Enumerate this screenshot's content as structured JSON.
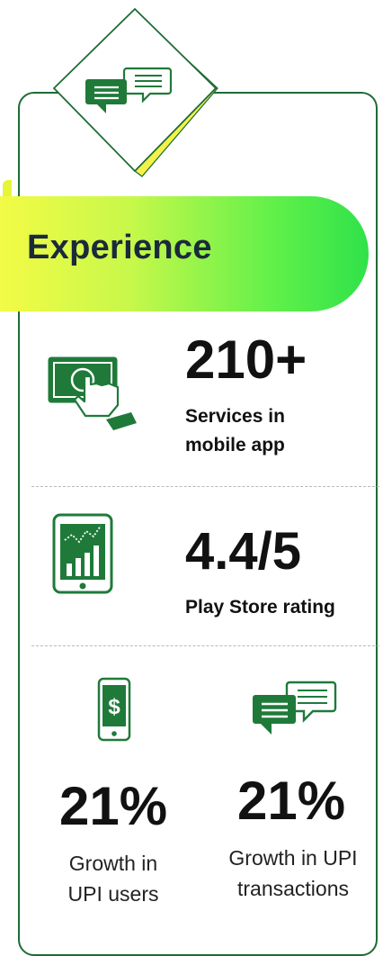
{
  "banner": {
    "title": "Experience"
  },
  "stats": [
    {
      "value": "210+",
      "label_line1": "Services in",
      "label_line2": "mobile app",
      "icon": "tap-screen-icon"
    },
    {
      "value": "4.4/5",
      "label": "Play Store rating",
      "icon": "phone-chart-icon"
    }
  ],
  "bottom_stats": [
    {
      "value": "21%",
      "label_line1": "Growth in",
      "label_line2": "UPI users",
      "icon": "phone-dollar-icon"
    },
    {
      "value": "21%",
      "label_line1": "Growth in UPI",
      "label_line2": "transactions",
      "icon": "chat-bubbles-icon"
    }
  ],
  "colors": {
    "primary_green": "#1f7a3a",
    "frame_green": "#1f6b35",
    "banner_start": "#f2fb45",
    "banner_end": "#2fe24a",
    "accent_yellow": "#f3f24a"
  }
}
